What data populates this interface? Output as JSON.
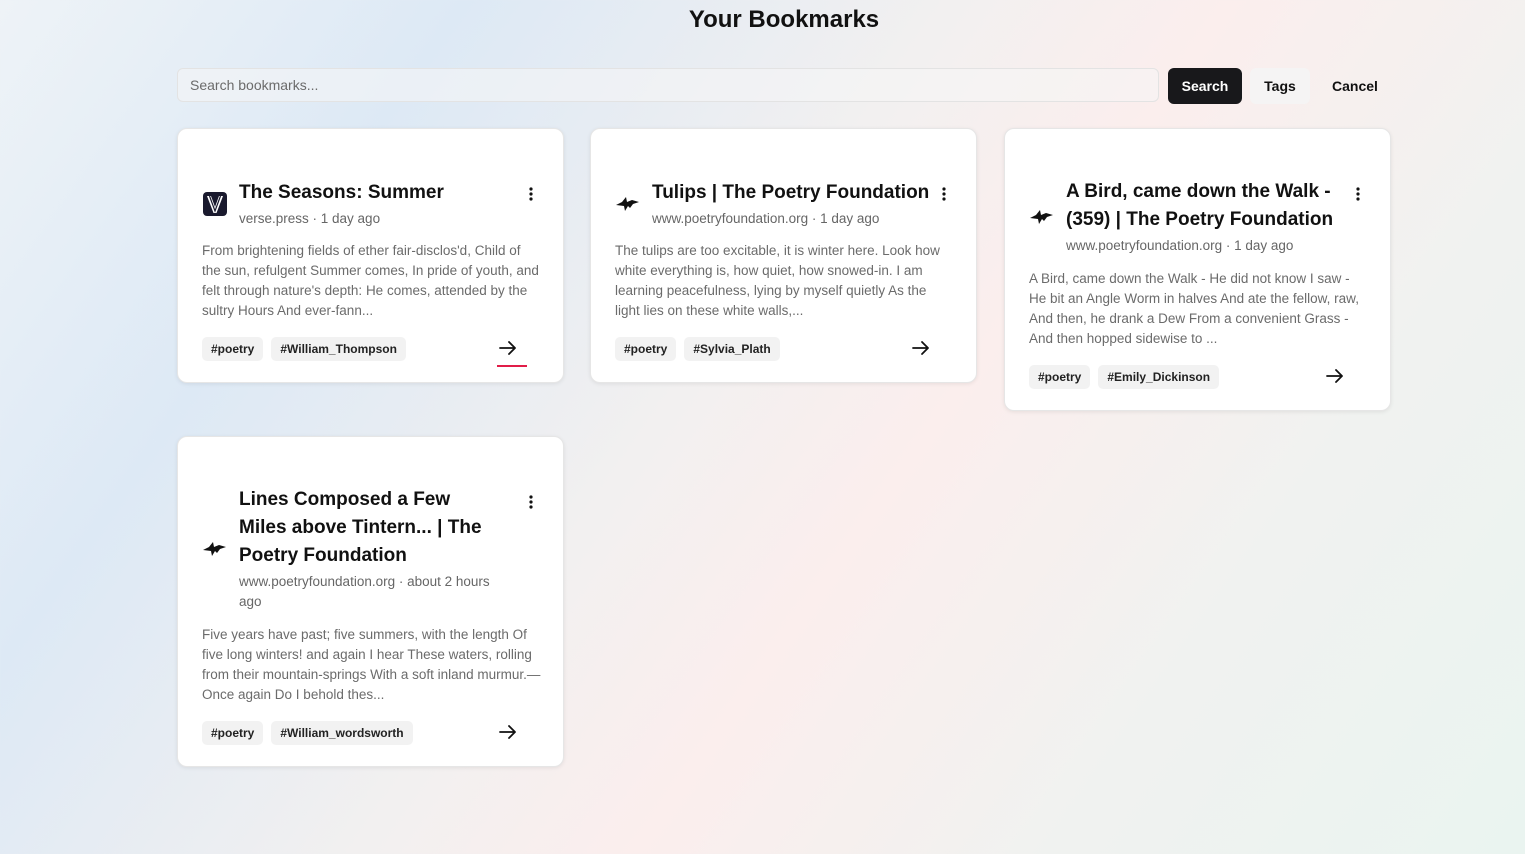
{
  "page_title": "Your Bookmarks",
  "search": {
    "placeholder": "Search bookmarks...",
    "value": ""
  },
  "buttons": {
    "search": "Search",
    "tags": "Tags",
    "cancel": "Cancel"
  },
  "bookmarks": [
    {
      "title": "The Seasons: Summer",
      "meta": "verse.press · 1 day ago",
      "favicon": "verse-press-logo-icon",
      "description": "From brightening fields of ether fair-disclos'd, Child of the sun, refulgent Summer comes, In pride of youth, and felt through nature's depth: He comes, attended by the sultry Hours And ever-fann...",
      "tags": [
        "#poetry",
        "#William_Thompson"
      ]
    },
    {
      "title": "Tulips | The Poetry Foundation",
      "meta": "www.poetryfoundation.org · 1 day ago",
      "favicon": "poetry-foundation-bird-icon",
      "description": "The tulips are too excitable, it is winter here. Look how white everything is, how quiet, how snowed-in. I am learning peacefulness, lying by myself quietly As the light lies on these white walls,...",
      "tags": [
        "#poetry",
        "#Sylvia_Plath"
      ]
    },
    {
      "title": "A Bird, came down the Walk - (359) | The Poetry Foundation",
      "meta": "www.poetryfoundation.org · 1 day ago",
      "favicon": "poetry-foundation-bird-icon",
      "description": "A Bird, came down the Walk - He did not know I saw - He bit an Angle Worm in halves And ate the fellow, raw, And then, he drank a Dew From a convenient Grass - And then hopped sidewise to ...",
      "tags": [
        "#poetry",
        "#Emily_Dickinson"
      ]
    },
    {
      "title": "Lines Composed a Few Miles above Tintern... | The Poetry Foundation",
      "meta": "www.poetryfoundation.org · about 2 hours ago",
      "favicon": "poetry-foundation-bird-icon",
      "description": "Five years have past; five summers, with the length Of five long winters! and again I hear These waters, rolling from their mountain-springs With a soft inland murmur.—Once again Do I behold thes...",
      "tags": [
        "#poetry",
        "#William_wordsworth"
      ]
    }
  ]
}
